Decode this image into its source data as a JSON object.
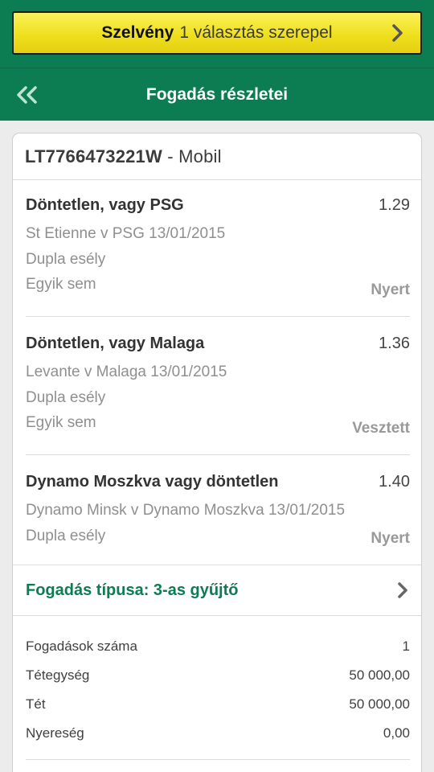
{
  "slip": {
    "bold_label": "Szelvény",
    "text": "1 választás szerepel"
  },
  "header": {
    "title": "Fogadás részletei"
  },
  "bet": {
    "id": "LT7766473221W",
    "channel": "- Mobil"
  },
  "selections": [
    {
      "name": "Döntetlen, vagy PSG",
      "odds": "1.29",
      "match": "St Etienne v PSG 13/01/2015",
      "market": "Dupla esély",
      "note": "Egyik sem",
      "status": "Nyert"
    },
    {
      "name": "Döntetlen, vagy Malaga",
      "odds": "1.36",
      "match": "Levante v Malaga 13/01/2015",
      "market": "Dupla esély",
      "note": "Egyik sem",
      "status": "Vesztett"
    },
    {
      "name": "Dynamo Moszkva vagy döntetlen",
      "odds": "1.40",
      "match": "Dynamo Minsk v Dynamo Moszkva 13/01/2015",
      "market": "Dupla esély",
      "status": "Nyert"
    }
  ],
  "bet_type": "Fogadás típusa: 3-as gyűjtő",
  "summary": [
    {
      "label": "Fogadások száma",
      "value": "1"
    },
    {
      "label": "Tétegység",
      "value": "50 000,00"
    },
    {
      "label": "Tét",
      "value": "50 000,00"
    },
    {
      "label": "Nyereség",
      "value": "0,00"
    }
  ],
  "colors": {
    "brand_green": "#0c7c52",
    "slip_yellow": "#efe01d"
  },
  "icons": {
    "back": "double-chevron-left-icon",
    "forward": "chevron-right-icon"
  }
}
